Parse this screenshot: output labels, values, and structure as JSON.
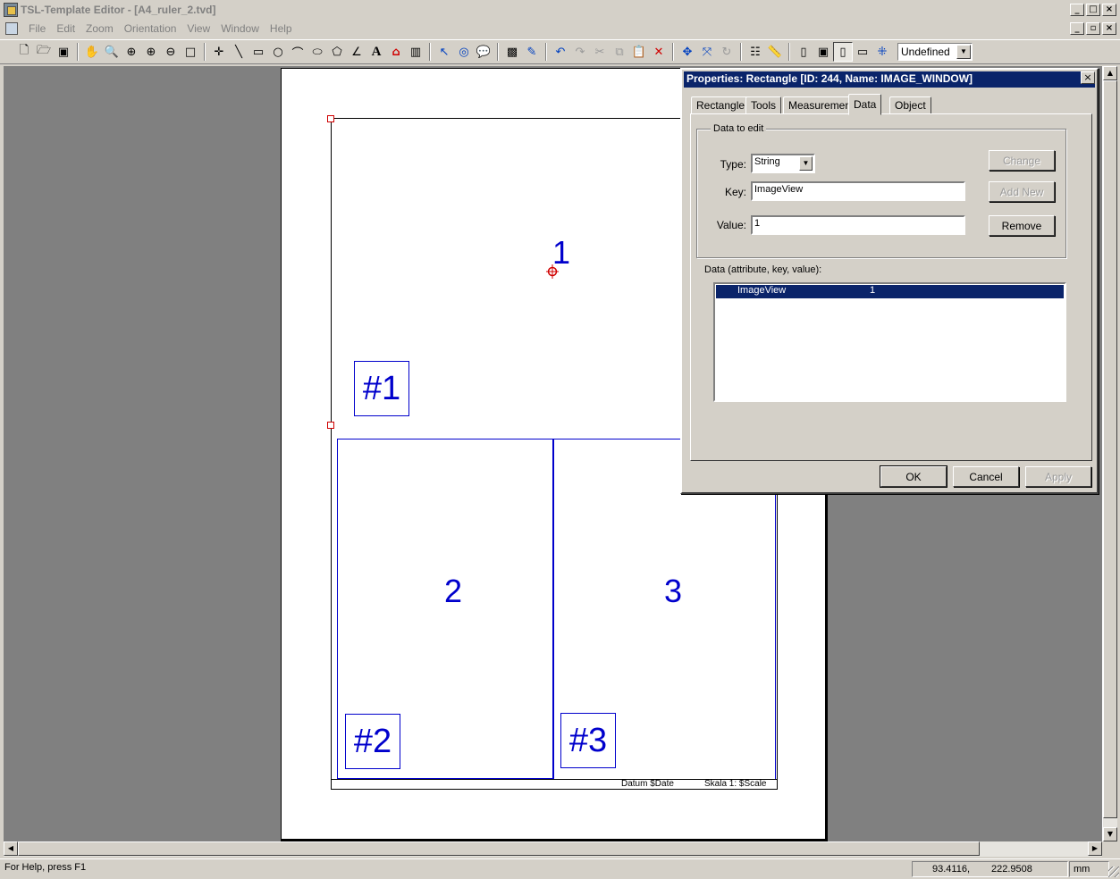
{
  "window": {
    "title": "TSL-Template Editor - [A4_ruler_2.tvd]",
    "buttons": [
      "_",
      "□",
      "×"
    ],
    "doc_buttons": [
      "_",
      "▫",
      "×"
    ]
  },
  "menu": [
    "File",
    "Edit",
    "Zoom",
    "Orientation",
    "View",
    "Window",
    "Help"
  ],
  "toolbar": {
    "zoom_value": "Undefined"
  },
  "canvas": {
    "region_1_number": "1",
    "region_2_number": "2",
    "region_3_number": "3",
    "tag_1": "#1",
    "tag_2": "#2",
    "tag_3": "#3",
    "footer_date": "Datum  $Date",
    "footer_scale": "Skala  1: $Scale"
  },
  "dialog": {
    "title": "Properties: Rectangle [ID: 244, Name: IMAGE_WINDOW]",
    "tabs": [
      "Rectangle",
      "Tools",
      "Measurement",
      "Data",
      "Object"
    ],
    "active_tab": "Data",
    "group_label": "Data to edit",
    "type_label": "Type:",
    "type_value": "String",
    "key_label": "Key:",
    "key_value": "ImageView",
    "value_label": "Value:",
    "value_value": "1",
    "change_button": "Change",
    "add_new_button": "Add New",
    "remove_button": "Remove",
    "list_label": "Data (attribute, key, value):",
    "rows": [
      {
        "key": "ImageView",
        "value": "1"
      }
    ],
    "ok_button": "OK",
    "cancel_button": "Cancel",
    "apply_button": "Apply"
  },
  "status": {
    "help_text": "For Help, press F1",
    "coord_x": "93.4116,",
    "coord_y": "222.9508",
    "unit": "mm"
  }
}
